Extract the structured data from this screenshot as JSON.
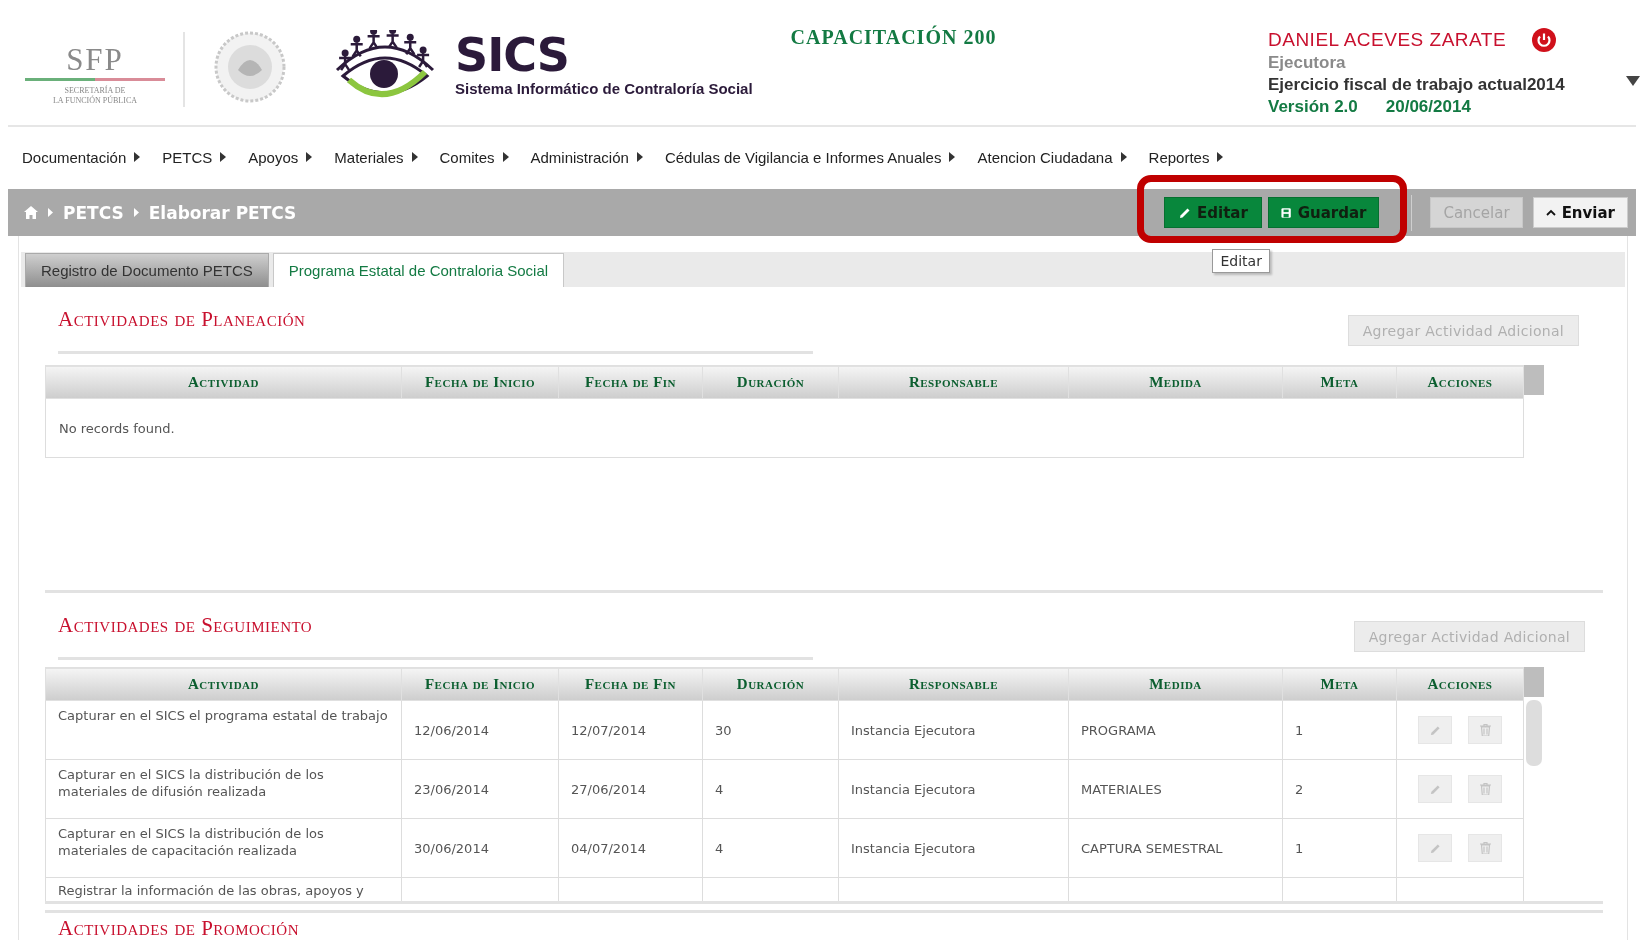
{
  "header": {
    "sfp_logo": {
      "acronym": "SFP",
      "caption_1": "SECRETARÍA DE",
      "caption_2": "LA FUNCIÓN PÚBLICA"
    },
    "app_logo": {
      "name": "SICS",
      "subtitle": "Sistema Informático de Contraloría Social"
    },
    "environment": "CAPACITACIÓN 200",
    "user": {
      "name": "DANIEL ACEVES ZARATE",
      "role": "Ejecutora",
      "fiscal_year": "Ejercicio fiscal de trabajo actual2014",
      "version": "Versión 2.0",
      "date": "20/06/2014"
    }
  },
  "menu": [
    "Documentación",
    "PETCS",
    "Apoyos",
    "Materiales",
    "Comites",
    "Administración",
    "Cédulas de Vigilancia e Informes Anuales",
    "Atencion Ciudadana",
    "Reportes"
  ],
  "breadcrumb": [
    "PETCS",
    "Elaborar PETCS"
  ],
  "toolbar": {
    "highlight": true,
    "highlighted_buttons": [
      {
        "label": "Editar",
        "kind": "edit",
        "disabled": false,
        "tooltip": "Editar"
      },
      {
        "label": "Guardar",
        "kind": "save",
        "disabled": false
      }
    ],
    "buttons": [
      {
        "label": "Cancelar",
        "kind": "cancel",
        "disabled": true
      },
      {
        "label": "Enviar",
        "kind": "send",
        "disabled": false
      }
    ]
  },
  "tabs": [
    {
      "label": "Registro de Documento PETCS",
      "selected": false
    },
    {
      "label": "Programa Estatal de Contraloria Social",
      "selected": true
    }
  ],
  "sections": [
    {
      "title": "Actividades de Planeación",
      "add_button": {
        "label": "Agregar Actividad Adicional",
        "disabled": true
      },
      "columns": [
        "Actividad",
        "Fecha de Inicio",
        "Fecha de Fin",
        "Duración",
        "Responsable",
        "Medida",
        "Meta",
        "Acciones"
      ],
      "empty_message": "No records found."
    },
    {
      "title": "Actividades de Seguimiento",
      "add_button": {
        "label": "Agregar Actividad Adicional",
        "disabled": true
      },
      "columns": [
        "Actividad",
        "Fecha de Inicio",
        "Fecha de Fin",
        "Duración",
        "Responsable",
        "Medida",
        "Meta",
        "Acciones"
      ],
      "rows": [
        {
          "cells": [
            "Capturar en el SICS el programa estatal de trabajo",
            "12/06/2014",
            "12/07/2014",
            "30",
            "Instancia Ejecutora",
            "PROGRAMA",
            "1"
          ],
          "actions": true
        },
        {
          "cells": [
            "Capturar en el SICS la distribución de los materiales de difusión realizada",
            "23/06/2014",
            "27/06/2014",
            "4",
            "Instancia Ejecutora",
            "MATERIALES",
            "2"
          ],
          "actions": true
        },
        {
          "cells": [
            "Capturar en el SICS la distribución de los materiales de capacitación realizada",
            "30/06/2014",
            "04/07/2014",
            "4",
            "Instancia Ejecutora",
            "CAPTURA SEMESTRAL",
            "1"
          ],
          "actions": true
        },
        {
          "cells": [
            "Registrar la información de las obras, apoyos y"
          ],
          "actions": false
        }
      ]
    },
    {
      "title": "Actividades de Promoción"
    }
  ]
}
